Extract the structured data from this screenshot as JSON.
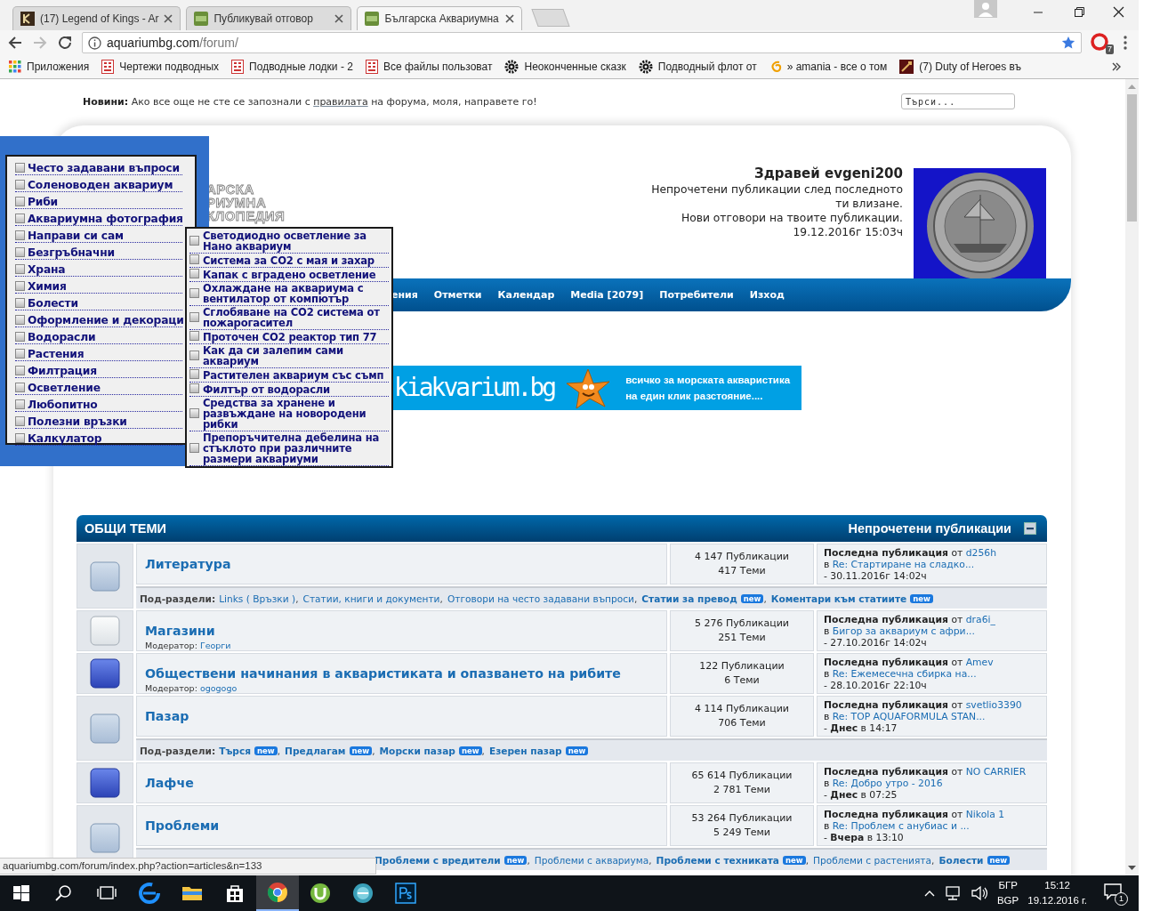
{
  "browser": {
    "tabs": [
      {
        "title": "(17) Legend of Kings - Ar",
        "kind": "game",
        "selected": false
      },
      {
        "title": "Публикувай отговор",
        "kind": "forum",
        "selected": false
      },
      {
        "title": "Българска Аквариумна",
        "kind": "forum",
        "selected": true
      }
    ],
    "address": {
      "host": "aquariumbg.com",
      "path": "/forum/"
    },
    "extension_badge": "7",
    "bookmarks": [
      {
        "label": "Приложения",
        "kind": "apps"
      },
      {
        "label": "Чертежи подводных",
        "kind": "grid"
      },
      {
        "label": "Подводные лодки - 2",
        "kind": "grid"
      },
      {
        "label": "Все файлы пользоват",
        "kind": "grid"
      },
      {
        "label": "Неоконченные сказк",
        "kind": "gear"
      },
      {
        "label": "Подводный флот от",
        "kind": "gear"
      },
      {
        "label": "» amania - все о том",
        "kind": "curl"
      },
      {
        "label": "(7) Duty of Heroes въ",
        "kind": "game"
      }
    ]
  },
  "news": {
    "label": "Новини:",
    "text_before": "Ако все още не сте се запознали с",
    "link": "правилата",
    "text_after": "на форума, моля, направете го!"
  },
  "search": {
    "placeholder": "Търси..."
  },
  "header": {
    "logo_lines": [
      "АРСКА",
      "РИУМНА",
      "КЛОПЕДИЯ"
    ],
    "greeting": "Здравей evgeni200",
    "links": [
      "Непрочетени публикации след последното ти влизане.",
      "Нови отговори на твоите публикации."
    ],
    "datetime": "19.12.2016г 15:03ч"
  },
  "nav": [
    {
      "label": "ения"
    },
    {
      "label": "Отметки"
    },
    {
      "label": "Календар"
    },
    {
      "label": "Media [2079]"
    },
    {
      "label": "Потребители"
    },
    {
      "label": "Изход"
    }
  ],
  "banner": {
    "site": "kiakvarium.bg",
    "tagline": [
      "всичко за морската акваристика",
      "на един клик разстояние...."
    ]
  },
  "menu": {
    "items": [
      {
        "label": "Често задавани въпроси"
      },
      {
        "label": "Соленоводен аквариум"
      },
      {
        "label": "Риби"
      },
      {
        "label": "Аквариумна фотография"
      },
      {
        "label": "Направи си сам"
      },
      {
        "label": "Безгръбначни"
      },
      {
        "label": "Храна"
      },
      {
        "label": "Химия"
      },
      {
        "label": "Болести"
      },
      {
        "label": "Оформление и декораци"
      },
      {
        "label": "Водорасли"
      },
      {
        "label": "Растения"
      },
      {
        "label": "Филтрация"
      },
      {
        "label": "Осветление"
      },
      {
        "label": "Любопитно"
      },
      {
        "label": "Полезни връзки"
      },
      {
        "label": "Калкулатор"
      }
    ],
    "submenu": [
      {
        "label": "Светодиодно осветление за Нано аквариум"
      },
      {
        "label": "Система за CO2 с мая и захар"
      },
      {
        "label": "Капак с вградено осветление"
      },
      {
        "label": "Охлаждане на аквариума с вентилатор от компютър"
      },
      {
        "label": "Сглобяване на CO2 система от пожарогасител"
      },
      {
        "label": "Проточен CO2 реактор тип 77"
      },
      {
        "label": "Как да си залепим сами аквариум"
      },
      {
        "label": "Растителен аквариум със съмп"
      },
      {
        "label": "Филтър от водорасли"
      },
      {
        "label": "Средства за хранене и развъждане на новородени рибки"
      },
      {
        "label": "Препоръчителна дебелина на стъклото при различните размери аквариуми"
      }
    ]
  },
  "category": {
    "title": "ОБЩИ ТЕМИ",
    "unread_link": "Непрочетени публикации",
    "boards": [
      {
        "name": "Литература",
        "kind": "no_new",
        "posts": "4 147 Публикации",
        "topics": "417 Теми",
        "last": {
          "label": "Последна публикация",
          "by": "от",
          "author": "d256h",
          "in": "в",
          "topic": "Re: Стартиране на сладко...",
          "date": "- 30.11.2016г 14:02ч"
        },
        "subboards": {
          "label": "Под-раздели:",
          "items": [
            {
              "name": "Links ( Връзки )",
              "sep": ","
            },
            {
              "name": "Статии, книги и документи",
              "sep": ","
            },
            {
              "name": "Отговори на често задавани въпроси",
              "sep": ","
            },
            {
              "name": "Статии за превод",
              "badge": "new",
              "sep": ","
            },
            {
              "name": "Коментари към статиите",
              "badge": "new"
            }
          ]
        }
      },
      {
        "name": "Магазини",
        "kind": "redirect",
        "moderator": {
          "label": "Модератор:",
          "name": "Георги"
        },
        "posts": "5 276 Публикации",
        "topics": "251 Теми",
        "last": {
          "label": "Последна публикация",
          "by": "от",
          "author": "dra6i_",
          "in": "в",
          "topic": "Бигор за аквариум с афри...",
          "date": "- 27.10.2016г 14:02ч"
        }
      },
      {
        "name": "Обществени начинания в акваристиката и опазването на рибите",
        "kind": "new",
        "moderator": {
          "label": "Модератор:",
          "name": "ogogogo"
        },
        "posts": "122 Публикации",
        "topics": "6 Теми",
        "last": {
          "label": "Последна публикация",
          "by": "от",
          "author": "Amev",
          "in": "в",
          "topic": "Re: Ежемесечна сбирка на...",
          "date": "- 28.10.2016г 22:10ч"
        }
      },
      {
        "name": "Пазар",
        "kind": "no_new",
        "posts": "4 114 Публикации",
        "topics": "706 Теми",
        "last": {
          "label": "Последна публикация",
          "by": "от",
          "author": "svetlio3390",
          "in": "в",
          "topic": "Re: TOP AQUAFORMULA STAN...",
          "date": "- **Днес** в 14:17"
        },
        "subboards": {
          "label": "Под-раздели:",
          "items": [
            {
              "name": "Търся",
              "badge": "new",
              "sep": ","
            },
            {
              "name": "Предлагам",
              "badge": "new",
              "sep": ","
            },
            {
              "name": "Морски пазар",
              "badge": "new",
              "sep": ","
            },
            {
              "name": "Езерен пазар",
              "badge": "new"
            }
          ]
        }
      },
      {
        "name": "Лафче",
        "kind": "new",
        "posts": "65 614 Публикации",
        "topics": "2 781 Теми",
        "last": {
          "label": "Последна публикация",
          "by": "от",
          "author": "NO CARRIER",
          "in": "в",
          "topic": "Re: Добро утро - 2016",
          "date": "- **Днес** в 07:25"
        }
      },
      {
        "name": "Проблеми",
        "kind": "no_new",
        "posts": "53 264 Публикации",
        "topics": "5 249 Теми",
        "last": {
          "label": "Последна публикация",
          "by": "от",
          "author": "Nikola 1",
          "in": "в",
          "topic": "Re: Проблем с анубиас и ...",
          "date": "- **Вчера** в 13:10"
        },
        "subboards": {
          "items": [
            {
              "name": "Проблеми с вредители",
              "badge": "new",
              "sep": ","
            },
            {
              "name": "Проблеми с аквариума",
              "sep": ","
            },
            {
              "name": "Проблеми с техниката",
              "badge": "new",
              "sep": ","
            },
            {
              "name": "Проблеми с растенията",
              "sep": ","
            },
            {
              "name": "Болести",
              "badge": "new"
            }
          ]
        }
      }
    ]
  },
  "status_url": "aquariumbg.com/forum/index.php?action=articles&n=133",
  "taskbar": {
    "apps": [
      {
        "kind": "search"
      },
      {
        "kind": "taskview"
      },
      {
        "kind": "edge"
      },
      {
        "kind": "folder"
      },
      {
        "kind": "store"
      },
      {
        "kind": "chrome",
        "selected": true
      },
      {
        "kind": "torrent"
      },
      {
        "kind": "bs"
      },
      {
        "kind": "ps"
      }
    ],
    "lang": [
      "БГР",
      "BGP"
    ],
    "time": "15:12",
    "date": "19.12.2016 г.",
    "notifications": "1"
  }
}
